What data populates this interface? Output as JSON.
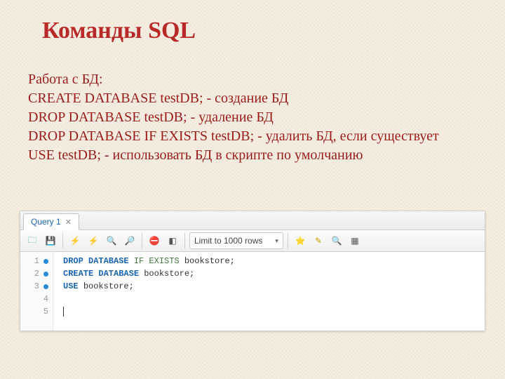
{
  "slide": {
    "title": "Команды SQL",
    "body": {
      "heading": "Работа с БД:",
      "line1": "CREATE DATABASE testDB; - создание БД",
      "line2": "DROP DATABASE testDB; - удаление БД",
      "line3": "DROP DATABASE IF EXISTS testDB; - удалить БД, если существует",
      "line4": "USE testDB; - использовать БД в скрипте по умолчанию"
    }
  },
  "editor": {
    "tab_label": "Query 1",
    "limit_label": "Limit to 1000 rows",
    "gutter": [
      "1",
      "2",
      "3",
      "4",
      "5"
    ],
    "bp_active": [
      true,
      true,
      true,
      false,
      false
    ],
    "code": {
      "l1_kw1": "DROP DATABASE",
      "l1_kw2": " IF EXISTS ",
      "l1_nm": "bookstore;",
      "l2_kw": "CREATE DATABASE ",
      "l2_nm": "bookstore;",
      "l3_kw": "USE ",
      "l3_nm": "bookstore;"
    }
  }
}
